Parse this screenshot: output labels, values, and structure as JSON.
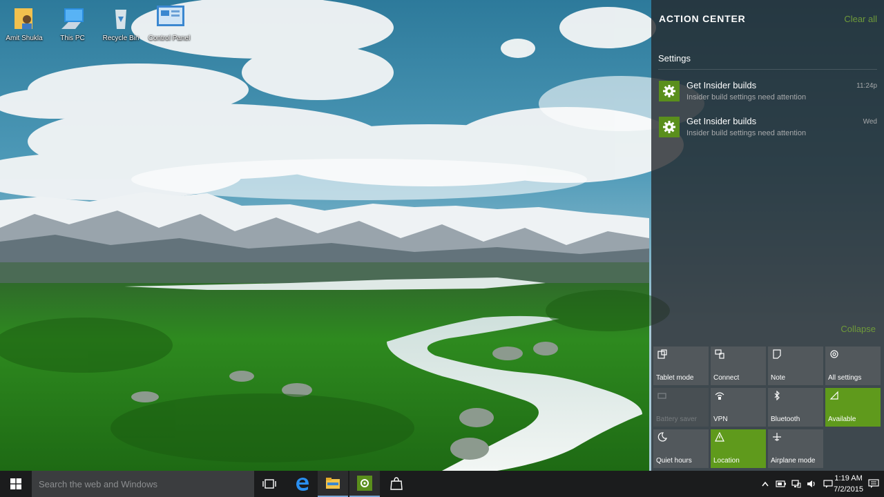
{
  "desktop": {
    "icons": [
      {
        "label": "Amit Shukla",
        "icon": "user-folder-icon"
      },
      {
        "label": "This PC",
        "icon": "computer-icon"
      },
      {
        "label": "Recycle Bin",
        "icon": "recycle-bin-icon"
      },
      {
        "label": "Control Panel",
        "icon": "control-panel-icon"
      }
    ]
  },
  "action_center": {
    "title": "ACTION CENTER",
    "clear_all": "Clear all",
    "group_title": "Settings",
    "notifications": [
      {
        "title": "Get Insider builds",
        "body": "Insider build settings need attention",
        "time": "11:24p",
        "icon": "gear-icon"
      },
      {
        "title": "Get Insider builds",
        "body": "Insider build settings need attention",
        "time": "Wed",
        "icon": "gear-icon"
      }
    ],
    "collapse": "Collapse",
    "quick_actions": [
      {
        "label": "Tablet mode",
        "icon": "tablet-mode-icon",
        "state": "off"
      },
      {
        "label": "Connect",
        "icon": "connect-icon",
        "state": "off"
      },
      {
        "label": "Note",
        "icon": "note-icon",
        "state": "off"
      },
      {
        "label": "All settings",
        "icon": "settings-icon",
        "state": "off"
      },
      {
        "label": "Battery saver",
        "icon": "battery-saver-icon",
        "state": "disabled"
      },
      {
        "label": "VPN",
        "icon": "vpn-icon",
        "state": "off"
      },
      {
        "label": "Bluetooth",
        "icon": "bluetooth-icon",
        "state": "off"
      },
      {
        "label": "Available",
        "icon": "wifi-icon",
        "state": "on"
      },
      {
        "label": "Quiet hours",
        "icon": "quiet-hours-icon",
        "state": "off"
      },
      {
        "label": "Location",
        "icon": "location-icon",
        "state": "on"
      },
      {
        "label": "Airplane mode",
        "icon": "airplane-mode-icon",
        "state": "off"
      }
    ]
  },
  "taskbar": {
    "search_placeholder": "Search the web and Windows",
    "pinned": [
      "task-view-icon",
      "edge-icon",
      "file-explorer-icon",
      "settings-app-icon",
      "store-icon"
    ],
    "tray_icons": [
      "chevron-up-icon",
      "battery-icon",
      "network-icon",
      "volume-icon",
      "message-icon"
    ],
    "time": "1:19 AM",
    "date": "7/2/2015"
  },
  "colors": {
    "accent": "#5f9a1c",
    "accent_text": "#6f9a3a",
    "taskbar": "#1b1c1d",
    "search_box": "#3b3d3f"
  }
}
